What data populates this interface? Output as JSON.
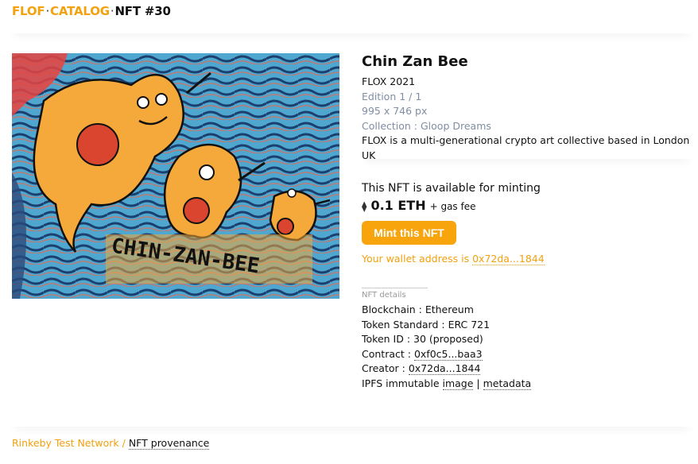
{
  "breadcrumb": {
    "home": "FLOF",
    "catalog": "CATALOG",
    "current": "NFT #30",
    "separator": "·"
  },
  "artwork": {
    "caption_text": "CHIN-ZAN-BEE"
  },
  "nft": {
    "title": "Chin Zan Bee",
    "artist_year": "FLOX 2021",
    "edition": "Edition 1 / 1",
    "dimensions": "995 x 746 px",
    "collection": "Collection : Gloop Dreams",
    "description": "FLOX is a multi-generational crypto art collective based in London UK"
  },
  "mint": {
    "availability": "This NFT is available for minting",
    "currency_icon": "ethereum-icon",
    "currency_glyph": "⧫",
    "price": "0.1 ETH",
    "fee_note": "+ gas fee",
    "button_label": "Mint this NFT",
    "wallet_prefix": "Your wallet address is",
    "wallet_address": "0x72da...1844"
  },
  "details": {
    "label": "NFT details",
    "blockchain": "Blockchain : Ethereum",
    "token_standard": "Token Standard : ERC 721",
    "token_id": "Token ID : 30 (proposed)",
    "contract_prefix": "Contract :",
    "contract_address": "0xf0c5...baa3",
    "creator_prefix": "Creator :",
    "creator_address": "0x72da...1844",
    "ipfs_prefix": "IPFS immutable",
    "ipfs_image": "image",
    "ipfs_separator": "|",
    "ipfs_metadata": "metadata"
  },
  "footer": {
    "network": "Rinkeby Test Network /",
    "provenance_link": "NFT provenance"
  },
  "colors": {
    "accent": "#f7a40d",
    "muted_text": "#7f8ea3"
  }
}
